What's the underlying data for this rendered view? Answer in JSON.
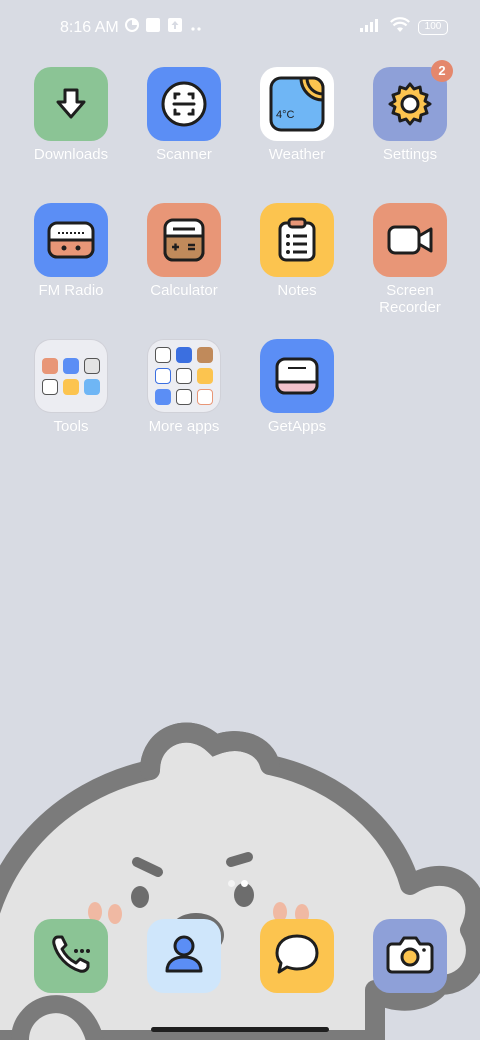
{
  "status_bar": {
    "time": "8:16 AM",
    "battery": "100",
    "left_icons": [
      "data-saver-icon",
      "square-notification-icon",
      "upload-notification-icon",
      "more-dots-icon"
    ],
    "right_icons": [
      "signal-icon",
      "wifi-icon",
      "battery-icon"
    ]
  },
  "apps": [
    {
      "label": "Downloads",
      "icon": "download-icon",
      "color": "#8bc495"
    },
    {
      "label": "Scanner",
      "icon": "scanner-icon",
      "color": "#5b8ef5"
    },
    {
      "label": "Weather",
      "icon": "weather-icon",
      "color": "#ffffff",
      "temp": "4°C"
    },
    {
      "label": "Settings",
      "icon": "gear-icon",
      "color": "#8ea0d8",
      "badge": "2"
    },
    {
      "label": "FM Radio",
      "icon": "radio-icon",
      "color": "#5b8ef5"
    },
    {
      "label": "Calculator",
      "icon": "calculator-icon",
      "color": "#e89677"
    },
    {
      "label": "Notes",
      "icon": "notes-icon",
      "color": "#fcc44f"
    },
    {
      "label": "Screen Recorder",
      "icon": "video-camera-icon",
      "color": "#e89677"
    },
    {
      "label": "Tools",
      "icon": "folder-icon"
    },
    {
      "label": "More apps",
      "icon": "folder-icon"
    },
    {
      "label": "GetApps",
      "icon": "getapps-icon",
      "color": "#5b8ef5"
    }
  ],
  "dock": [
    {
      "name": "phone",
      "icon": "phone-icon",
      "color": "#8bc495"
    },
    {
      "name": "contacts",
      "icon": "contacts-icon",
      "color": "#cfe6fb"
    },
    {
      "name": "messages",
      "icon": "message-icon",
      "color": "#fcc44f"
    },
    {
      "name": "camera",
      "icon": "camera-icon",
      "color": "#8ea0d8"
    }
  ],
  "page_indicator": {
    "pages": 2,
    "current": 2
  },
  "colors": {
    "background": "#d8dbe3",
    "wallpaper_outline": "#787878",
    "wallpaper_fill": "#e2e2e2",
    "label": "#ffffff"
  }
}
